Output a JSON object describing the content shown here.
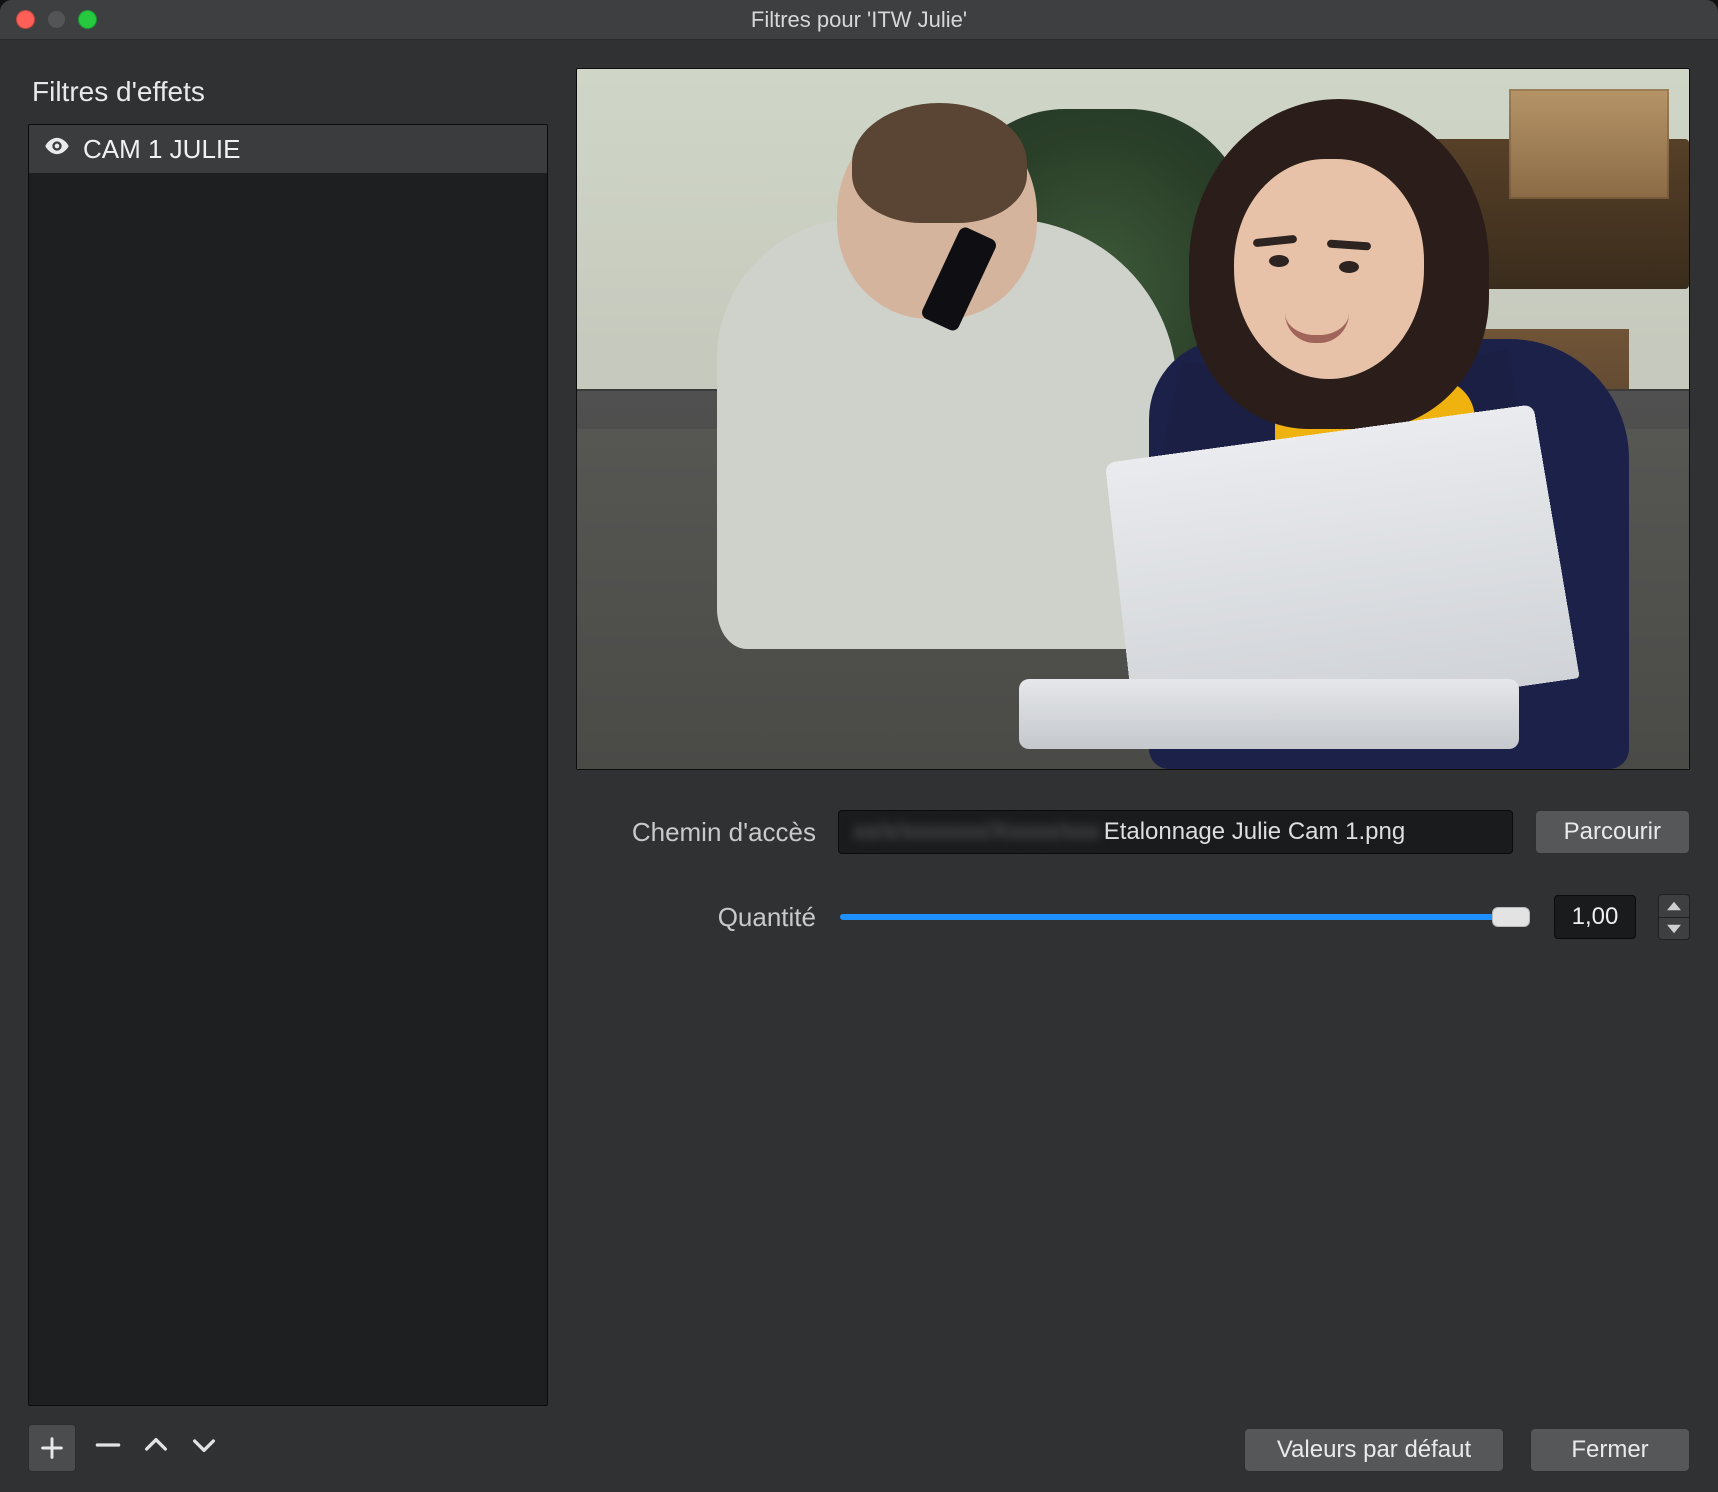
{
  "window": {
    "title": "Filtres pour 'ITW Julie'"
  },
  "sidebar": {
    "title": "Filtres d'effets",
    "items": [
      {
        "label": "CAM 1 JULIE",
        "visible": true
      }
    ]
  },
  "controls": {
    "path_label": "Chemin d'accès",
    "path_value": "Etalonnage Julie Cam 1.png",
    "browse_label": "Parcourir",
    "amount_label": "Quantité",
    "amount_value": "1,00",
    "amount_slider": 1.0
  },
  "footer": {
    "defaults_label": "Valeurs par défaut",
    "close_label": "Fermer"
  }
}
